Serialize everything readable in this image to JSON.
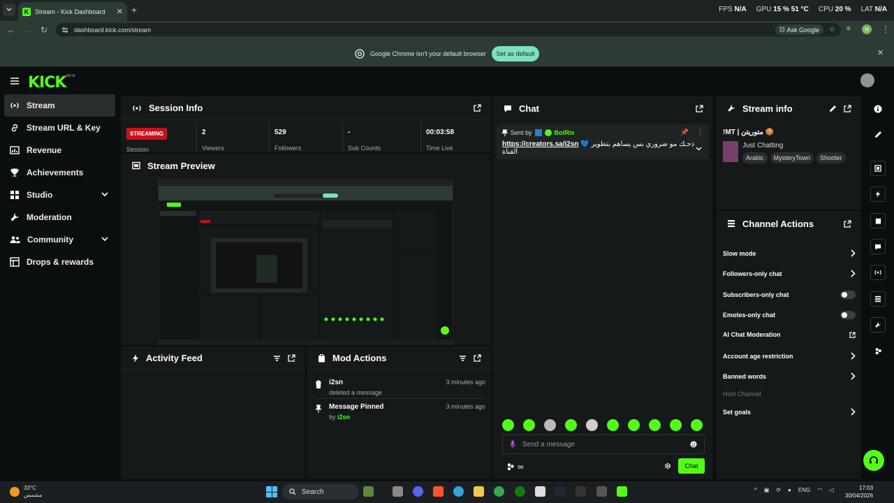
{
  "browser": {
    "tab_title": "Stream - Kick Dashboard",
    "url": "dashboard.kick.com/stream",
    "ask_google": "Ask Google",
    "profile_initial": "N",
    "infobar_message": "Google Chrome isn't your default browser",
    "set_default": "Set as default"
  },
  "overlay": {
    "fps_label": "FPS",
    "fps_value": "N/A",
    "gpu_label": "GPU",
    "gpu_value": "15 % 51 °C",
    "cpu_label": "CPU",
    "cpu_value": "20 %",
    "lat_label": "LAT",
    "lat_value": "N/A"
  },
  "brand": {
    "logo": "KICK",
    "beta": "BETA"
  },
  "sidebar": {
    "items": [
      {
        "label": "Stream",
        "icon": "broadcast-icon"
      },
      {
        "label": "Stream URL & Key",
        "icon": "link-icon"
      },
      {
        "label": "Revenue",
        "icon": "chart-icon"
      },
      {
        "label": "Achievements",
        "icon": "trophy-icon"
      },
      {
        "label": "Studio",
        "icon": "grid-icon"
      },
      {
        "label": "Moderation",
        "icon": "wrench-icon"
      },
      {
        "label": "Community",
        "icon": "people-icon"
      },
      {
        "label": "Drops & rewards",
        "icon": "gift-icon"
      }
    ]
  },
  "session": {
    "title": "Session Info",
    "badge": "STREAMING",
    "session_label": "Session",
    "stats": [
      {
        "value": "2",
        "label": "Viewers"
      },
      {
        "value": "529",
        "label": "Followers"
      },
      {
        "value": "-",
        "label": "Sub Counts"
      },
      {
        "value": "00:03:58",
        "label": "Time Live"
      }
    ]
  },
  "preview": {
    "title": "Stream Preview"
  },
  "activity": {
    "title": "Activity Feed"
  },
  "mod_actions": {
    "title": "Mod Actions",
    "items": [
      {
        "who": "i2sn",
        "sub": "deleted a message",
        "time": "3 minutes ago"
      },
      {
        "who": "Message Pinned",
        "sub_prefix": "by",
        "sub_user": "i2sn",
        "time": "3 minutes ago"
      }
    ]
  },
  "chat": {
    "title": "Chat",
    "pinned_sent_by": "Sent by",
    "pinned_user": "BotRix",
    "pinned_link": "https://creators.sa/i2sn",
    "pinned_text": "💙 ذحـك مو ضروري بس يساهم بتطوير القناة",
    "placeholder": "Send a message",
    "send_label": "Chat"
  },
  "stream_info": {
    "title": "Stream info",
    "stream_title": "!MT | متوريتن 🍪",
    "category": "Just Chatting",
    "tags": [
      "Arabic",
      "MysteryTown",
      "Shooter"
    ]
  },
  "channel_actions": {
    "title": "Channel Actions",
    "rows": [
      {
        "label": "Slow mode",
        "control": "chevron"
      },
      {
        "label": "Followers-only chat",
        "control": "chevron"
      },
      {
        "label": "Subscribers-only chat",
        "control": "toggle",
        "enabled": false
      },
      {
        "label": "Emotes-only chat",
        "control": "toggle",
        "enabled": false
      },
      {
        "label": "AI Chat Moderation",
        "control": "external"
      },
      {
        "label": "Account age restriction",
        "control": "chevron"
      },
      {
        "label": "Banned words",
        "control": "chevron"
      },
      {
        "label": "Host Channel",
        "control": "none",
        "disabled": true
      },
      {
        "label": "Set goals",
        "control": "chevron"
      }
    ]
  },
  "taskbar": {
    "temp": "33°C",
    "weather": "مشمس",
    "search": "Search",
    "lang": "ENG",
    "time": "17:03",
    "date": "30/04/2026"
  },
  "colors": {
    "accent": "#53fc18",
    "live": "#c8121c",
    "panel": "#16191a",
    "background": "#0b0e0f"
  }
}
